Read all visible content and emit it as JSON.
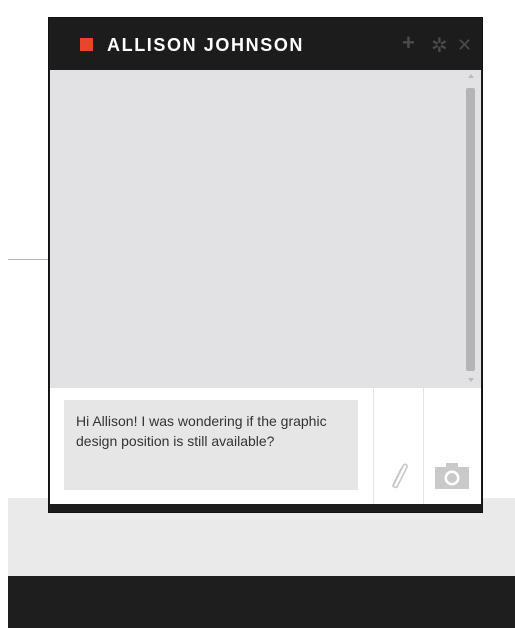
{
  "chat": {
    "contact_name": "ALLISON JOHNSON",
    "status_color": "#e8452c",
    "header_actions": [
      {
        "icon": "plus-icon",
        "glyph": "+"
      },
      {
        "icon": "gear-icon",
        "glyph": "✲"
      },
      {
        "icon": "close-icon",
        "glyph": "✕"
      }
    ],
    "message_draft": "Hi Allison! I was wondering if the graphic design position is still available?",
    "composer_actions": [
      {
        "icon": "paperclip-icon"
      },
      {
        "icon": "camera-icon"
      }
    ]
  },
  "colors": {
    "header_bg": "#1c1c1c",
    "messages_bg": "#e2e2e4",
    "input_bg": "#e6e6e6",
    "icon_gray": "#4b4b4b"
  }
}
